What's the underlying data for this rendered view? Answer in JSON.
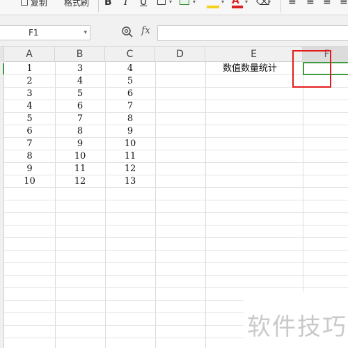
{
  "ribbon": {
    "copy_label": "复制",
    "format_painter_label": "格式刷",
    "bold": "B",
    "italic": "I",
    "underline": "U",
    "align_1": "≡",
    "align_2": "≡",
    "align_3": "≡",
    "align_4": "≡"
  },
  "formula_bar": {
    "name_box": "F1",
    "fx": "fx",
    "formula_value": ""
  },
  "columns": [
    "A",
    "B",
    "C",
    "D",
    "E",
    "F"
  ],
  "rows": [
    [
      "1",
      "3",
      "4"
    ],
    [
      "2",
      "4",
      "5"
    ],
    [
      "3",
      "5",
      "6"
    ],
    [
      "4",
      "6",
      "7"
    ],
    [
      "5",
      "7",
      "8"
    ],
    [
      "6",
      "8",
      "9"
    ],
    [
      "7",
      "9",
      "10"
    ],
    [
      "8",
      "10",
      "11"
    ],
    [
      "9",
      "11",
      "12"
    ],
    [
      "10",
      "12",
      "13"
    ]
  ],
  "e1_text": "数值数量统计",
  "selected_cell": "F1",
  "colors": {
    "selection": "#3f9b3f",
    "annotation": "#e41b1b",
    "highlight": "#f4d21a",
    "font_color": "#e02020"
  },
  "watermark": "软件技巧"
}
